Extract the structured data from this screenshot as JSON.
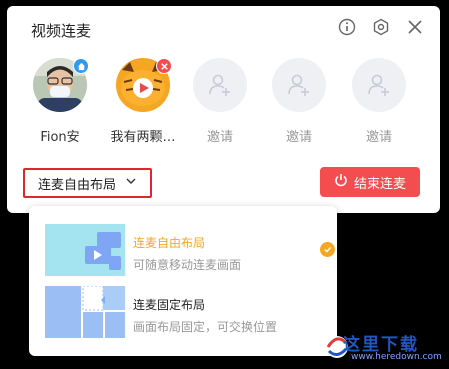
{
  "dialog": {
    "title": "视频连麦",
    "icons": [
      "info-icon",
      "gear-icon",
      "close-icon"
    ]
  },
  "members": [
    {
      "name": "Fion安",
      "type": "user",
      "badge": "home-icon",
      "badge_color": "#2e9bf0"
    },
    {
      "name": "我有两颗…",
      "type": "user",
      "badge": "remove-icon",
      "badge_color": "#f34d4f"
    },
    {
      "name": "邀请",
      "type": "invite"
    },
    {
      "name": "邀请",
      "type": "invite"
    },
    {
      "name": "邀请",
      "type": "invite"
    }
  ],
  "layout_select": {
    "label": "连麦自由布局",
    "icon": "chevron-down-icon"
  },
  "end_button": {
    "label": "结束连麦",
    "icon": "power-icon",
    "color": "#f34d4f"
  },
  "dropdown": {
    "options": [
      {
        "title": "连麦自由布局",
        "desc": "可随意移动连麦画面",
        "selected": true
      },
      {
        "title": "连麦固定布局",
        "desc": "画面布局固定，可交换位置",
        "selected": false
      }
    ]
  },
  "watermark": {
    "text": "这里下载",
    "url": "www.heredown.com"
  },
  "colors": {
    "accent": "#f5a623",
    "danger": "#f34d4f",
    "highlight_border": "#e3262a"
  }
}
